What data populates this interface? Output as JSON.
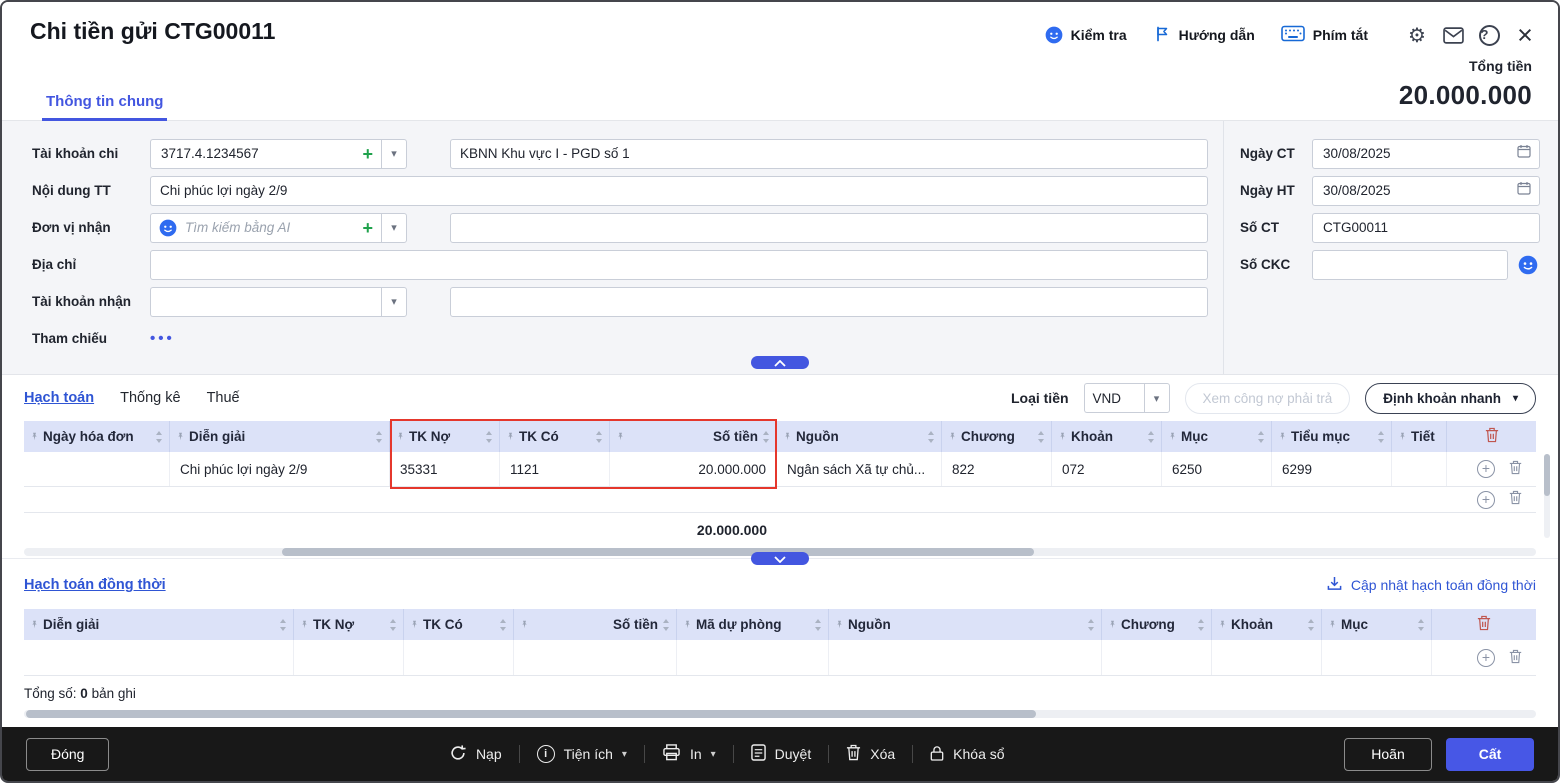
{
  "colors": {
    "accent_blue": "#4356e0",
    "link_blue": "#2f55d4",
    "highlight_red": "#e5372c",
    "save_button_blue": "#4757e6",
    "table_header_bg": "#dce2f8",
    "form_bg": "#f4f5f8",
    "bottom_bar_bg": "#181818"
  },
  "header": {
    "title": "Chi tiền gửi CTG00011",
    "check_label": "Kiểm tra",
    "guide_label": "Hướng dẫn",
    "shortcut_label": "Phím tắt",
    "total_label": "Tổng tiền",
    "total_value": "20.000.000"
  },
  "tabs": {
    "general": "Thông tin chung"
  },
  "form": {
    "tai_khoan_chi": {
      "label": "Tài khoản chi",
      "value": "3717.4.1234567",
      "detail": "KBNN Khu vực I - PGD số 1"
    },
    "noi_dung_tt": {
      "label": "Nội dung TT",
      "value": "Chi phúc lợi ngày 2/9"
    },
    "don_vi_nhan": {
      "label": "Đơn vị nhận",
      "placeholder": "Tìm kiếm bằng AI",
      "detail": ""
    },
    "dia_chi": {
      "label": "Địa chỉ",
      "value": ""
    },
    "tai_khoan_nhan": {
      "label": "Tài khoản nhận",
      "value": "",
      "detail": ""
    },
    "tham_chieu": {
      "label": "Tham chiếu",
      "more": "•••"
    },
    "ngay_ct": {
      "label": "Ngày CT",
      "value": "30/08/2025"
    },
    "ngay_ht": {
      "label": "Ngày HT",
      "value": "30/08/2025"
    },
    "so_ct": {
      "label": "Số CT",
      "value": "CTG00011"
    },
    "so_ckc": {
      "label": "Số CKC",
      "value": ""
    }
  },
  "accounting": {
    "tab_hach_toan": "Hạch toán",
    "tab_thong_ke": "Thống kê",
    "tab_thue": "Thuế",
    "currency_label": "Loại tiền",
    "currency_value": "VND",
    "debt_button_label": "Xem công nợ phải trả",
    "quick_entry_label": "Định khoản nhanh",
    "columns": {
      "invoice_date": "Ngày hóa đơn",
      "description": "Diễn giải",
      "debit": "TK Nợ",
      "credit": "TK Có",
      "amount": "Số tiền",
      "source": "Nguồn",
      "chapter": "Chương",
      "item": "Khoản",
      "section": "Mục",
      "sub_section": "Tiểu mục",
      "detail": "Tiết"
    },
    "row": {
      "invoice_date": "",
      "description": "Chi phúc lợi ngày 2/9",
      "debit": "35331",
      "credit": "1121",
      "amount": "20.000.000",
      "source": "Ngân sách Xã tự chủ...",
      "chapter": "822",
      "item": "072",
      "section": "6250",
      "sub_section": "6299",
      "detail": ""
    },
    "total": "20.000.000"
  },
  "simultaneous": {
    "title": "Hạch toán đồng thời",
    "update_label": "Cập nhật hạch toán đồng thời",
    "columns": {
      "description": "Diễn giải",
      "debit": "TK Nợ",
      "credit": "TK Có",
      "amount": "Số tiền",
      "provision_code": "Mã dự phòng",
      "source": "Nguồn",
      "chapter": "Chương",
      "item": "Khoản",
      "section": "Mục"
    },
    "record_count_prefix": "Tổng số:",
    "record_count": "0",
    "record_count_suffix": "bản ghi"
  },
  "footer": {
    "close_label": "Đóng",
    "reload_label": "Nạp",
    "utilities_label": "Tiện ích",
    "print_label": "In",
    "approve_label": "Duyệt",
    "delete_label": "Xóa",
    "lock_label": "Khóa sổ",
    "postpone_label": "Hoãn",
    "save_label": "Cất"
  }
}
